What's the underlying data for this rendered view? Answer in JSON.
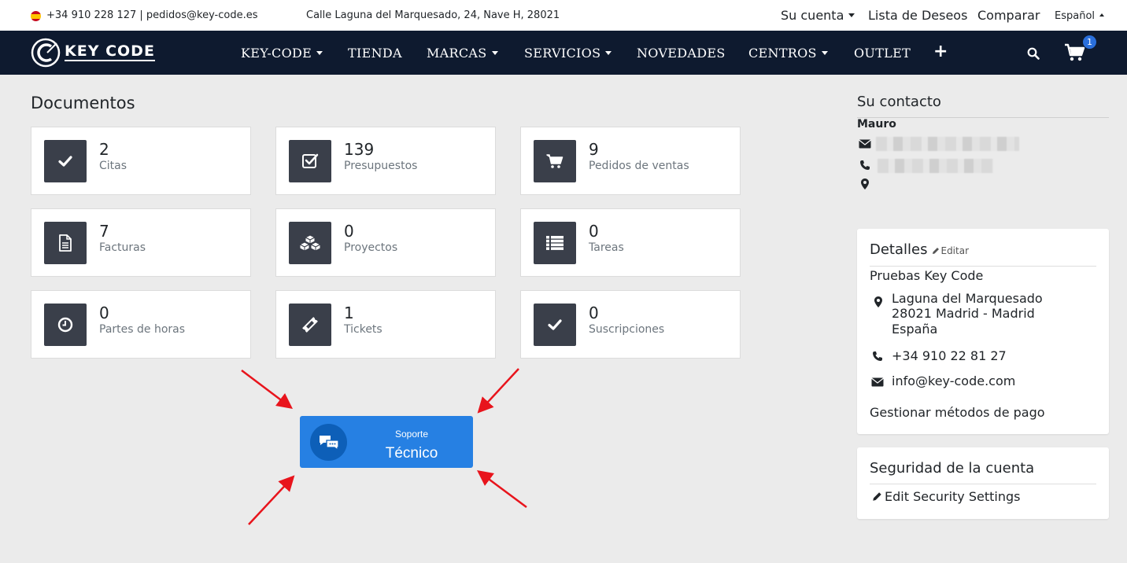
{
  "topbar": {
    "phone_email": "+34 910 228 127 | pedidos@key-code.es",
    "address": "Calle Laguna del Marquesado, 24, Nave H, 28021",
    "account": "Su cuenta",
    "wishlist": "Lista de Deseos",
    "compare": "Comparar",
    "language": "Español"
  },
  "navbar": {
    "logo_text": "KEY CODE",
    "items": [
      "KEY-CODE",
      "TIENDA",
      "MARCAS",
      "SERVICIOS",
      "NOVEDADES",
      "CENTROS",
      "OUTLET"
    ],
    "plus": "+",
    "cart_count": "1"
  },
  "main": {
    "title": "Documentos",
    "cards": [
      {
        "value": "2",
        "label": "Citas",
        "icon": "check-icon"
      },
      {
        "value": "139",
        "label": "Presupuestos",
        "icon": "checkbox-icon"
      },
      {
        "value": "9",
        "label": "Pedidos de ventas",
        "icon": "cart-icon"
      },
      {
        "value": "7",
        "label": "Facturas",
        "icon": "document-icon"
      },
      {
        "value": "0",
        "label": "Proyectos",
        "icon": "cubes-icon"
      },
      {
        "value": "0",
        "label": "Tareas",
        "icon": "list-icon"
      },
      {
        "value": "0",
        "label": "Partes de horas",
        "icon": "clock-icon"
      },
      {
        "value": "1",
        "label": "Tickets",
        "icon": "ticket-icon"
      },
      {
        "value": "0",
        "label": "Suscripciones",
        "icon": "check-icon"
      }
    ],
    "support": {
      "small": "Soporte",
      "big": "Técnico"
    }
  },
  "sidebar": {
    "contact_title": "Su contacto",
    "contact_name": "Mauro",
    "details_title": "Detalles",
    "edit": "Editar",
    "company": "Pruebas Key Code",
    "address_line1": "Laguna del Marquesado",
    "address_line2": "28021 Madrid - Madrid",
    "address_line3": "España",
    "phone": "+34 910 22 81 27",
    "email": "info@key-code.com",
    "payment": "Gestionar métodos de pago",
    "security_title": "Seguridad de la cuenta",
    "security_link": "Edit Security Settings"
  },
  "colors": {
    "navbar": "#0e1a2f",
    "support_button": "#2680e3",
    "card_icon_bg": "#3a3f4a",
    "arrows": "#e8141c",
    "badge": "#2a6fdb"
  }
}
